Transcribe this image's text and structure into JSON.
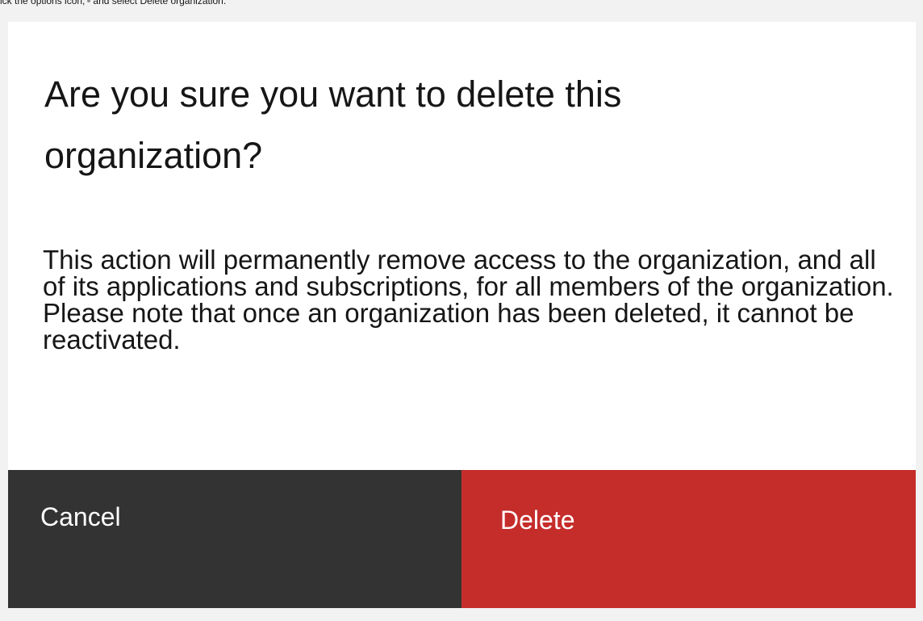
{
  "instruction": {
    "prefix": "ick the options icon,",
    "options_icon": "overflow-menu-icon",
    "suffix": "and select Delete organization."
  },
  "modal": {
    "heading": "Are you sure you want to delete this organization?",
    "body": "This action will permanently remove access to the organization, and all of its applications and subscriptions, for all members of the organization. Please note that once an organization has been deleted, it cannot be reactivated.",
    "cancel_label": "Cancel",
    "delete_label": "Delete"
  },
  "colors": {
    "page_background": "#f2f2f2",
    "modal_background": "#ffffff",
    "cancel_background": "#333333",
    "delete_background": "#c52d2b",
    "text": "#161616"
  }
}
